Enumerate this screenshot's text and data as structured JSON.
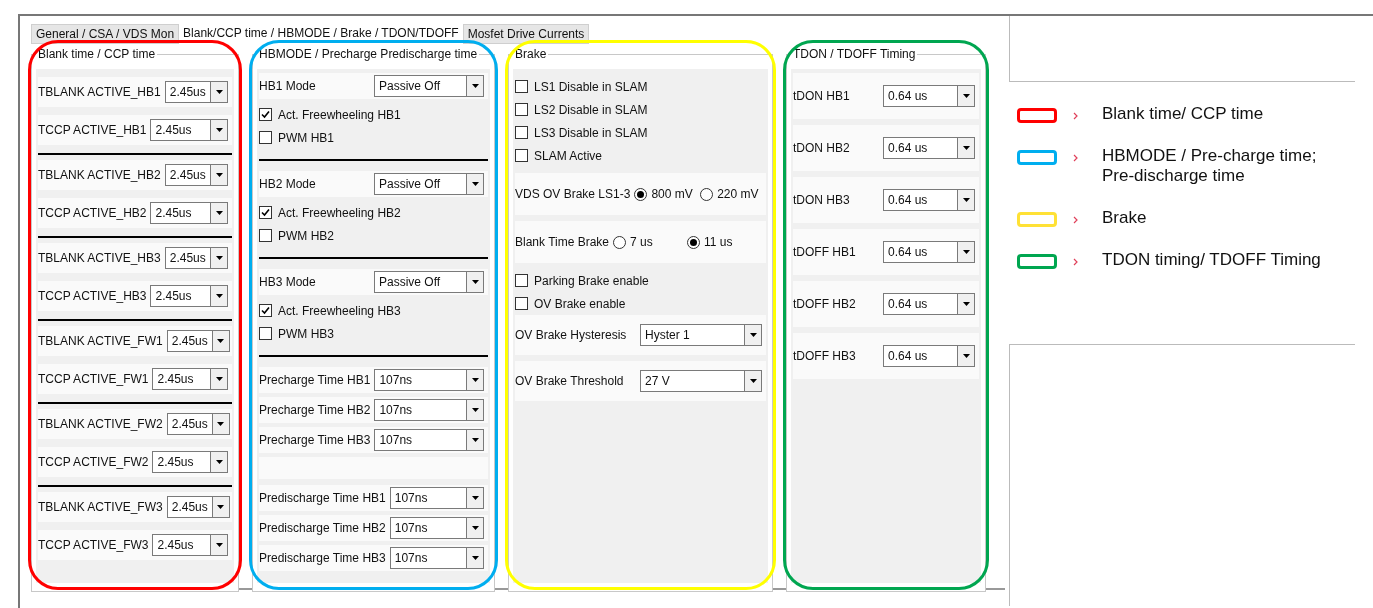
{
  "tabs": [
    {
      "label": "General / CSA / VDS Mon",
      "selected": false
    },
    {
      "label": "Blank/CCP time / HBMODE / Brake / TDON/TDOFF",
      "selected": true
    },
    {
      "label": "Mosfet Drive Currents",
      "selected": false
    }
  ],
  "groups": [
    {
      "kind": "blank",
      "title": "Blank time / CCP time",
      "color": "#ff0000",
      "items": [
        {
          "kind": "select",
          "label": "TBLANK ACTIVE_HB1",
          "value": "2.45us"
        },
        {
          "kind": "select",
          "label": "TCCP ACTIVE_HB1",
          "value": "2.45us"
        },
        {
          "kind": "separator"
        },
        {
          "kind": "select",
          "label": "TBLANK ACTIVE_HB2",
          "value": "2.45us"
        },
        {
          "kind": "select",
          "label": "TCCP ACTIVE_HB2",
          "value": "2.45us"
        },
        {
          "kind": "separator"
        },
        {
          "kind": "select",
          "label": "TBLANK ACTIVE_HB3",
          "value": "2.45us"
        },
        {
          "kind": "select",
          "label": "TCCP ACTIVE_HB3",
          "value": "2.45us"
        },
        {
          "kind": "separator"
        },
        {
          "kind": "select",
          "label": "TBLANK ACTIVE_FW1",
          "value": "2.45us"
        },
        {
          "kind": "select",
          "label": "TCCP ACTIVE_FW1",
          "value": "2.45us"
        },
        {
          "kind": "separator"
        },
        {
          "kind": "select",
          "label": "TBLANK ACTIVE_FW2",
          "value": "2.45us"
        },
        {
          "kind": "select",
          "label": "TCCP ACTIVE_FW2",
          "value": "2.45us"
        },
        {
          "kind": "separator"
        },
        {
          "kind": "select",
          "label": "TBLANK ACTIVE_FW3",
          "value": "2.45us"
        },
        {
          "kind": "select",
          "label": "TCCP ACTIVE_FW3",
          "value": "2.45us"
        }
      ]
    },
    {
      "kind": "hbmode",
      "title": "HBMODE / Precharge Predischarge time",
      "color": "#00aeef",
      "items": [
        {
          "kind": "select",
          "label": "HB1 Mode",
          "value": "Passive Off"
        },
        {
          "kind": "check",
          "label": "Act. Freewheeling HB1",
          "checked": true
        },
        {
          "kind": "check",
          "label": "PWM HB1",
          "checked": false
        },
        {
          "kind": "separator"
        },
        {
          "kind": "select",
          "label": "HB2 Mode",
          "value": "Passive Off"
        },
        {
          "kind": "check",
          "label": "Act. Freewheeling HB2",
          "checked": true
        },
        {
          "kind": "check",
          "label": "PWM HB2",
          "checked": false
        },
        {
          "kind": "separator"
        },
        {
          "kind": "select",
          "label": "HB3 Mode",
          "value": "Passive Off"
        },
        {
          "kind": "check",
          "label": "Act. Freewheeling HB3",
          "checked": true
        },
        {
          "kind": "check",
          "label": "PWM HB3",
          "checked": false
        },
        {
          "kind": "separator"
        },
        {
          "kind": "select",
          "label": "Precharge Time HB1",
          "value": "107ns"
        },
        {
          "kind": "select",
          "label": "Precharge Time HB2",
          "value": "107ns"
        },
        {
          "kind": "select",
          "label": "Precharge Time HB3",
          "value": "107ns"
        },
        {
          "kind": "gap"
        },
        {
          "kind": "select",
          "label": "Predischarge Time HB1",
          "value": "107ns"
        },
        {
          "kind": "select",
          "label": "Predischarge Time HB2",
          "value": "107ns"
        },
        {
          "kind": "select",
          "label": "Predischarge Time HB3",
          "value": "107ns"
        }
      ]
    },
    {
      "kind": "brake",
      "title": "Brake",
      "color": "#ffff00",
      "items": [
        {
          "kind": "check",
          "label": "LS1 Disable in SLAM",
          "checked": false
        },
        {
          "kind": "check",
          "label": "LS2 Disable in SLAM",
          "checked": false
        },
        {
          "kind": "check",
          "label": "LS3 Disable in SLAM",
          "checked": false
        },
        {
          "kind": "check",
          "label": "SLAM Active",
          "checked": false
        },
        {
          "kind": "radio",
          "label": "VDS OV Brake LS1-3",
          "options": [
            {
              "label": "800 mV",
              "selected": true
            },
            {
              "label": "220 mV",
              "selected": false
            }
          ]
        },
        {
          "kind": "radio",
          "label": "Blank Time Brake",
          "options": [
            {
              "label": "7 us",
              "selected": false
            },
            {
              "label": "11 us",
              "selected": true
            }
          ]
        },
        {
          "kind": "check",
          "label": "Parking Brake enable",
          "checked": false
        },
        {
          "kind": "check",
          "label": "OV Brake enable",
          "checked": false
        },
        {
          "kind": "select",
          "label": "OV Brake Hysteresis",
          "value": "Hyster 1"
        },
        {
          "kind": "select",
          "label": "OV Brake Threshold",
          "value": "27 V"
        }
      ]
    },
    {
      "kind": "timing",
      "title": "TDON / TDOFF Timing",
      "color": "#00a650",
      "items": [
        {
          "kind": "select",
          "label": "tDON HB1",
          "value": "0.64 us"
        },
        {
          "kind": "select",
          "label": "tDON HB2",
          "value": "0.64 us"
        },
        {
          "kind": "select",
          "label": "tDON HB3",
          "value": "0.64 us"
        },
        {
          "kind": "select",
          "label": "tDOFF HB1",
          "value": "0.64 us"
        },
        {
          "kind": "select",
          "label": "tDOFF HB2",
          "value": "0.64 us"
        },
        {
          "kind": "select",
          "label": "tDOFF HB3",
          "value": "0.64 us"
        }
      ]
    }
  ],
  "legend": [
    {
      "label": "Blank time/ CCP time",
      "color": "#ff0000"
    },
    {
      "label": "HBMODE / Pre-charge time; Pre-discharge time",
      "color": "#00aeef"
    },
    {
      "label": "Brake",
      "color": "#ffe135"
    },
    {
      "label": "TDON timing/ TDOFF Timing",
      "color": "#00a650"
    }
  ]
}
